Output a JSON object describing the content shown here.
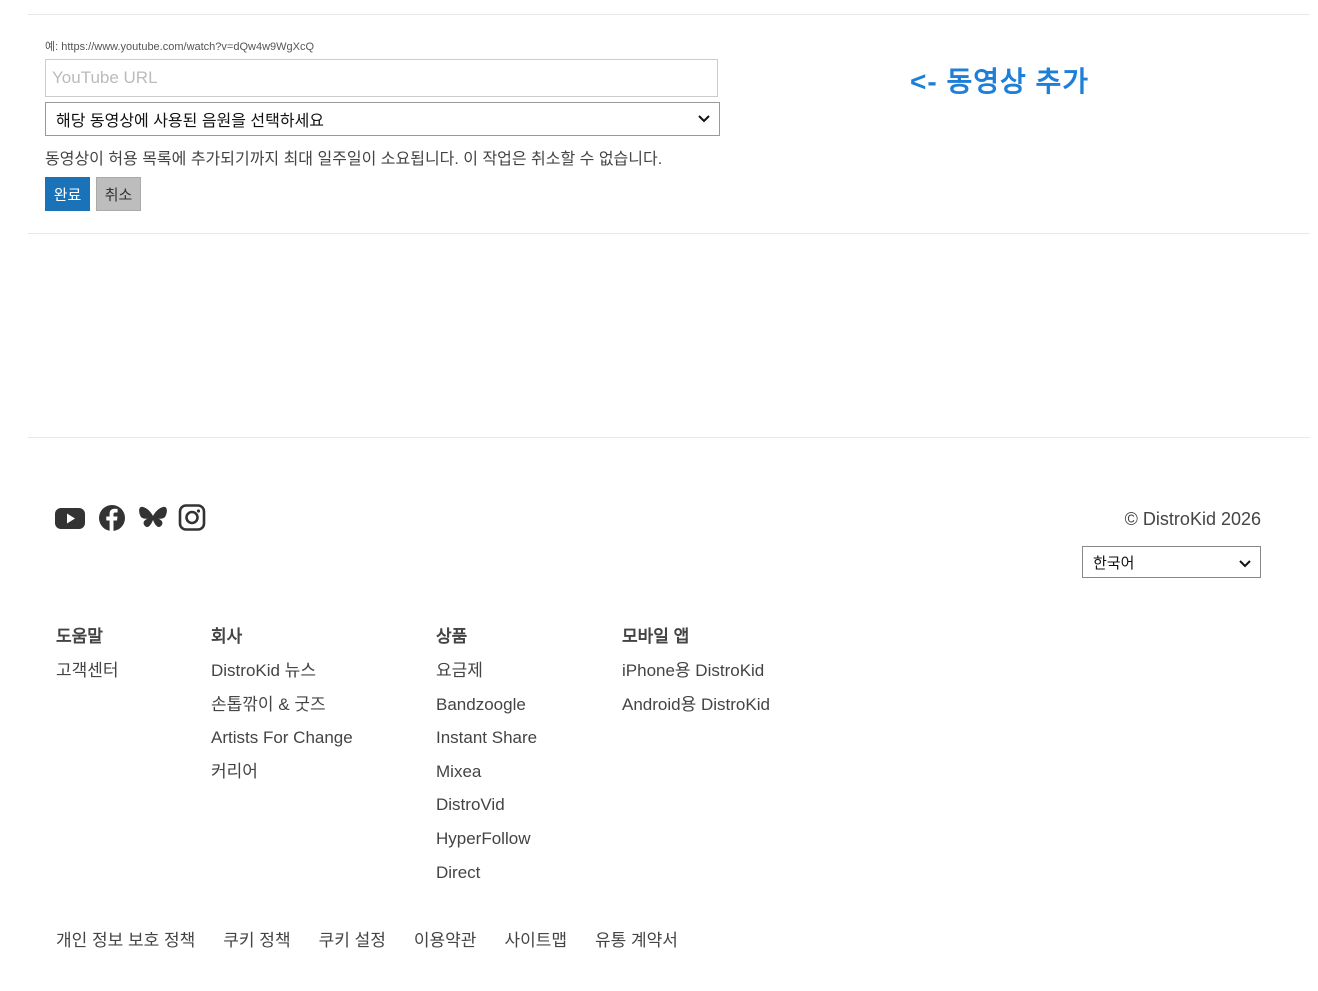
{
  "video_form": {
    "example_text": "예: https://www.youtube.com/watch?v=dQw4w9WgXcQ",
    "url_placeholder": "YouTube URL",
    "song_select_value": "해당 동영상에 사용된 음원을 선택하세요",
    "note": "동영상이 허용 목록에 추가되기까지 최대 일주일이 소요됩니다. 이 작업은 취소할 수 없습니다.",
    "done_label": "완료",
    "cancel_label": "취소"
  },
  "annotation": "<- 동영상 추가",
  "footer": {
    "social_icons": [
      "youtube-icon",
      "facebook-icon",
      "bluesky-icon",
      "instagram-icon"
    ],
    "copyright": "© DistroKid 2026",
    "language_value": "한국어",
    "columns": [
      {
        "heading": "도움말",
        "links": [
          "고객센터"
        ]
      },
      {
        "heading": "회사",
        "links": [
          "DistroKid 뉴스",
          "손톱깎이 & 굿즈",
          "Artists For Change",
          "커리어"
        ]
      },
      {
        "heading": "상품",
        "links": [
          "요금제",
          "Bandzoogle",
          "Instant Share",
          "Mixea",
          "DistroVid",
          "HyperFollow",
          "Direct"
        ]
      },
      {
        "heading": "모바일 앱",
        "links": [
          "iPhone용 DistroKid",
          "Android용 DistroKid"
        ]
      }
    ],
    "bottom_links": [
      "개인 정보 보호 정책",
      "쿠키 정책",
      "쿠키 설정",
      "이용약관",
      "사이트맵",
      "유통 계약서"
    ]
  },
  "colors": {
    "primary_button": "#1a73b8",
    "annotation": "#1e7fd8",
    "icon": "#333333"
  }
}
